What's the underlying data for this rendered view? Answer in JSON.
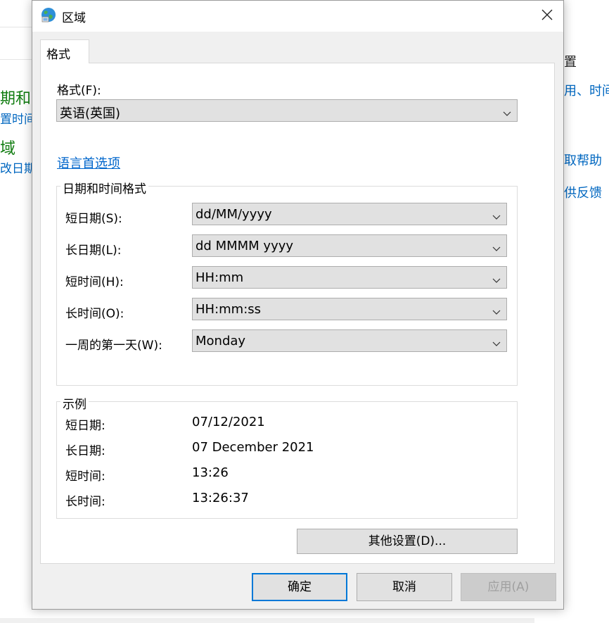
{
  "background": {
    "green_text_1": "期和",
    "blue_text_1": "置时间",
    "green_text_2": "域",
    "blue_text_2": "改日期",
    "right_dark_1": "置",
    "right_blue_1": "用、时间",
    "right_blue_2": "取帮助",
    "right_blue_3": "供反馈"
  },
  "dialog": {
    "title": "区域",
    "close_icon": "close-icon",
    "tab_label": "格式",
    "format_label": "格式(F):",
    "format_value": "英语(英国)",
    "language_link": "语言首选项",
    "datetime_group_title": "日期和时间格式",
    "fields": [
      {
        "label": "短日期(S):",
        "value": "dd/MM/yyyy"
      },
      {
        "label": "长日期(L):",
        "value": "dd MMMM yyyy"
      },
      {
        "label": "短时间(H):",
        "value": "HH:mm"
      },
      {
        "label": "长时间(O):",
        "value": "HH:mm:ss"
      },
      {
        "label": "一周的第一天(W):",
        "value": "Monday"
      }
    ],
    "example_group_title": "示例",
    "examples": [
      {
        "label": "短日期:",
        "value": "07/12/2021"
      },
      {
        "label": "长日期:",
        "value": "07 December 2021"
      },
      {
        "label": "短时间:",
        "value": "13:26"
      },
      {
        "label": "长时间:",
        "value": "13:26:37"
      }
    ],
    "other_settings_button": "其他设置(D)...",
    "ok_button": "确定",
    "cancel_button": "取消",
    "apply_button": "应用(A)"
  },
  "colors": {
    "link": "#0066cc",
    "accent": "#0078d7",
    "background_green": "#107c10"
  }
}
